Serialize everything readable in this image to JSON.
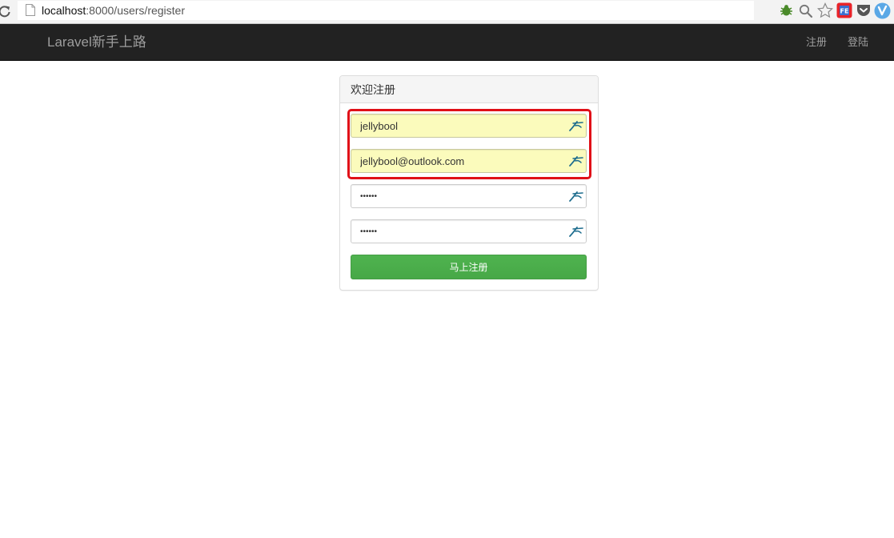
{
  "browser": {
    "url_host": "localhost",
    "url_rest": ":8000/users/register",
    "extensions": [
      "bug-icon",
      "zoom-icon",
      "star-icon",
      "fe-icon",
      "pocket-icon",
      "v-icon"
    ]
  },
  "navbar": {
    "brand": "Laravel新手上路",
    "links": [
      "注册",
      "登陆"
    ]
  },
  "panel": {
    "title": "欢迎注册"
  },
  "form": {
    "name": "jellybool",
    "email": "jellybool@outlook.com",
    "password": "••••••",
    "password_confirmation": "••••••",
    "submit_label": "马上注册"
  },
  "colors": {
    "navbar_bg": "#222222",
    "navbar_text": "#9d9d9d",
    "autofill_bg": "#fbfbbc",
    "highlight_border": "#e01018",
    "submit_bg": "#4cae4c"
  }
}
